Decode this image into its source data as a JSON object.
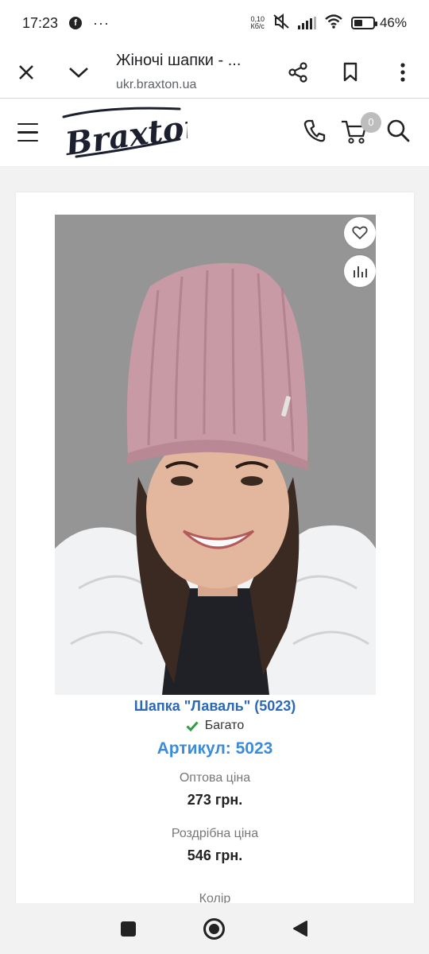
{
  "status_bar": {
    "time": "17:23",
    "more": "···",
    "net_speed_value": "0,10",
    "net_speed_unit": "Кб/с",
    "battery": "46%",
    "battery_level": 0.46
  },
  "browser": {
    "title": "Жіночі шапки - ...",
    "url": "ukr.braxton.ua"
  },
  "site": {
    "logo_text": "Braxton",
    "cart_count": "0"
  },
  "product": {
    "title": "Шапка \"Лаваль\" (5023)",
    "stock_status": "Багато",
    "sku": "Артикул: 5023",
    "wholesale_label": "Оптова ціна",
    "wholesale_price": "273 грн.",
    "retail_label": "Роздрібна ціна",
    "retail_price": "546 грн.",
    "color_label": "Колір"
  },
  "colors": {
    "title_blue": "#2b68b6",
    "sku_blue": "#3b8cd8",
    "check_green": "#2e9e3e",
    "hat_pink": "#c79aa6"
  }
}
